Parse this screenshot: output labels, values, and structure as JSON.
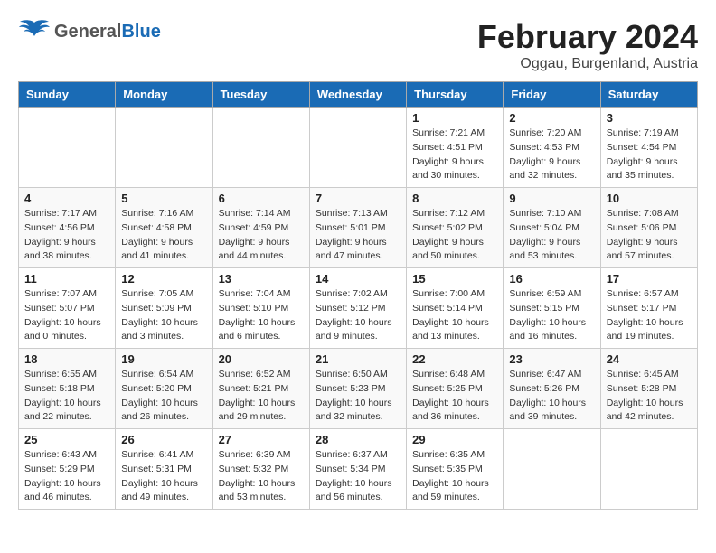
{
  "header": {
    "logo_general": "General",
    "logo_blue": "Blue",
    "month_year": "February 2024",
    "location": "Oggau, Burgenland, Austria"
  },
  "days_of_week": [
    "Sunday",
    "Monday",
    "Tuesday",
    "Wednesday",
    "Thursday",
    "Friday",
    "Saturday"
  ],
  "weeks": [
    [
      {
        "day": "",
        "info": ""
      },
      {
        "day": "",
        "info": ""
      },
      {
        "day": "",
        "info": ""
      },
      {
        "day": "",
        "info": ""
      },
      {
        "day": "1",
        "info": "Sunrise: 7:21 AM\nSunset: 4:51 PM\nDaylight: 9 hours\nand 30 minutes."
      },
      {
        "day": "2",
        "info": "Sunrise: 7:20 AM\nSunset: 4:53 PM\nDaylight: 9 hours\nand 32 minutes."
      },
      {
        "day": "3",
        "info": "Sunrise: 7:19 AM\nSunset: 4:54 PM\nDaylight: 9 hours\nand 35 minutes."
      }
    ],
    [
      {
        "day": "4",
        "info": "Sunrise: 7:17 AM\nSunset: 4:56 PM\nDaylight: 9 hours\nand 38 minutes."
      },
      {
        "day": "5",
        "info": "Sunrise: 7:16 AM\nSunset: 4:58 PM\nDaylight: 9 hours\nand 41 minutes."
      },
      {
        "day": "6",
        "info": "Sunrise: 7:14 AM\nSunset: 4:59 PM\nDaylight: 9 hours\nand 44 minutes."
      },
      {
        "day": "7",
        "info": "Sunrise: 7:13 AM\nSunset: 5:01 PM\nDaylight: 9 hours\nand 47 minutes."
      },
      {
        "day": "8",
        "info": "Sunrise: 7:12 AM\nSunset: 5:02 PM\nDaylight: 9 hours\nand 50 minutes."
      },
      {
        "day": "9",
        "info": "Sunrise: 7:10 AM\nSunset: 5:04 PM\nDaylight: 9 hours\nand 53 minutes."
      },
      {
        "day": "10",
        "info": "Sunrise: 7:08 AM\nSunset: 5:06 PM\nDaylight: 9 hours\nand 57 minutes."
      }
    ],
    [
      {
        "day": "11",
        "info": "Sunrise: 7:07 AM\nSunset: 5:07 PM\nDaylight: 10 hours\nand 0 minutes."
      },
      {
        "day": "12",
        "info": "Sunrise: 7:05 AM\nSunset: 5:09 PM\nDaylight: 10 hours\nand 3 minutes."
      },
      {
        "day": "13",
        "info": "Sunrise: 7:04 AM\nSunset: 5:10 PM\nDaylight: 10 hours\nand 6 minutes."
      },
      {
        "day": "14",
        "info": "Sunrise: 7:02 AM\nSunset: 5:12 PM\nDaylight: 10 hours\nand 9 minutes."
      },
      {
        "day": "15",
        "info": "Sunrise: 7:00 AM\nSunset: 5:14 PM\nDaylight: 10 hours\nand 13 minutes."
      },
      {
        "day": "16",
        "info": "Sunrise: 6:59 AM\nSunset: 5:15 PM\nDaylight: 10 hours\nand 16 minutes."
      },
      {
        "day": "17",
        "info": "Sunrise: 6:57 AM\nSunset: 5:17 PM\nDaylight: 10 hours\nand 19 minutes."
      }
    ],
    [
      {
        "day": "18",
        "info": "Sunrise: 6:55 AM\nSunset: 5:18 PM\nDaylight: 10 hours\nand 22 minutes."
      },
      {
        "day": "19",
        "info": "Sunrise: 6:54 AM\nSunset: 5:20 PM\nDaylight: 10 hours\nand 26 minutes."
      },
      {
        "day": "20",
        "info": "Sunrise: 6:52 AM\nSunset: 5:21 PM\nDaylight: 10 hours\nand 29 minutes."
      },
      {
        "day": "21",
        "info": "Sunrise: 6:50 AM\nSunset: 5:23 PM\nDaylight: 10 hours\nand 32 minutes."
      },
      {
        "day": "22",
        "info": "Sunrise: 6:48 AM\nSunset: 5:25 PM\nDaylight: 10 hours\nand 36 minutes."
      },
      {
        "day": "23",
        "info": "Sunrise: 6:47 AM\nSunset: 5:26 PM\nDaylight: 10 hours\nand 39 minutes."
      },
      {
        "day": "24",
        "info": "Sunrise: 6:45 AM\nSunset: 5:28 PM\nDaylight: 10 hours\nand 42 minutes."
      }
    ],
    [
      {
        "day": "25",
        "info": "Sunrise: 6:43 AM\nSunset: 5:29 PM\nDaylight: 10 hours\nand 46 minutes."
      },
      {
        "day": "26",
        "info": "Sunrise: 6:41 AM\nSunset: 5:31 PM\nDaylight: 10 hours\nand 49 minutes."
      },
      {
        "day": "27",
        "info": "Sunrise: 6:39 AM\nSunset: 5:32 PM\nDaylight: 10 hours\nand 53 minutes."
      },
      {
        "day": "28",
        "info": "Sunrise: 6:37 AM\nSunset: 5:34 PM\nDaylight: 10 hours\nand 56 minutes."
      },
      {
        "day": "29",
        "info": "Sunrise: 6:35 AM\nSunset: 5:35 PM\nDaylight: 10 hours\nand 59 minutes."
      },
      {
        "day": "",
        "info": ""
      },
      {
        "day": "",
        "info": ""
      }
    ]
  ]
}
